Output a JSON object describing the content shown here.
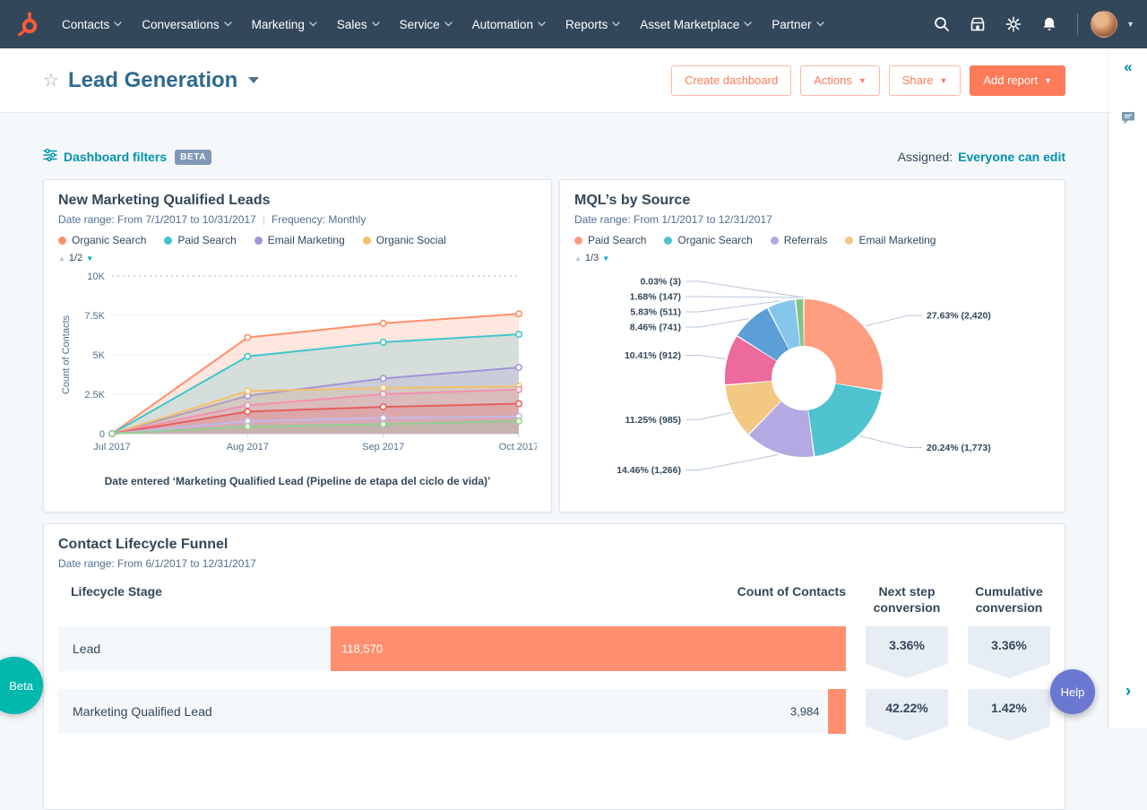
{
  "colors": {
    "primary": "#ff7a59",
    "link": "#0091ae",
    "nav": "#33475b"
  },
  "nav": {
    "items": [
      {
        "label": "Contacts"
      },
      {
        "label": "Conversations"
      },
      {
        "label": "Marketing"
      },
      {
        "label": "Sales"
      },
      {
        "label": "Service"
      },
      {
        "label": "Automation"
      },
      {
        "label": "Reports"
      },
      {
        "label": "Asset Marketplace"
      },
      {
        "label": "Partner"
      }
    ]
  },
  "header": {
    "title": "Lead Generation",
    "buttons": {
      "create_dashboard": "Create dashboard",
      "actions": "Actions",
      "share": "Share",
      "add_report": "Add report"
    }
  },
  "filters": {
    "label": "Dashboard filters",
    "beta": "BETA",
    "assigned_label": "Assigned:",
    "assigned_value": "Everyone can edit"
  },
  "chart_data": [
    {
      "type": "area",
      "title": "New Marketing Qualified Leads",
      "date_range": "Date range: From 7/1/2017 to 10/31/2017",
      "frequency": "Frequency: Monthly",
      "legend_page": "1/2",
      "x": [
        "Jul 2017",
        "Aug 2017",
        "Sep 2017",
        "Oct 2017"
      ],
      "ylabel": "Count of Contacts",
      "ylim": [
        0,
        10000
      ],
      "yticks": [
        "0",
        "2.5K",
        "5K",
        "7.5K",
        "10K"
      ],
      "series": [
        {
          "name": "Organic Search",
          "color": "#ff8f6b",
          "values": [
            0,
            6100,
            7000,
            7600
          ]
        },
        {
          "name": "Paid Search",
          "color": "#3fc6cd",
          "values": [
            0,
            4900,
            5800,
            6300
          ]
        },
        {
          "name": "Email Marketing",
          "color": "#a393d8",
          "values": [
            0,
            2400,
            3500,
            4200
          ]
        },
        {
          "name": "Organic Social",
          "color": "#f3c06e",
          "values": [
            0,
            2700,
            2900,
            3000
          ]
        },
        {
          "name": "",
          "color": "#f48fb1",
          "values": [
            0,
            1800,
            2500,
            2800
          ]
        },
        {
          "name": "",
          "color": "#e5605e",
          "values": [
            0,
            1400,
            1700,
            1900
          ]
        },
        {
          "name": "",
          "color": "#c5b9e8",
          "values": [
            0,
            800,
            1000,
            1100
          ]
        },
        {
          "name": "",
          "color": "#8fd08f",
          "values": [
            0,
            450,
            600,
            800
          ]
        }
      ],
      "caption": "Date entered ‘Marketing Qualified Lead (Pipeline de etapa del ciclo de vida)’"
    },
    {
      "type": "pie",
      "title": "MQL’s by Source",
      "date_range": "Date range: From 1/1/2017 to 12/31/2017",
      "legend_page": "1/3",
      "slices": [
        {
          "name": "Paid Search",
          "label": "27.63% (2,420)",
          "pct": 27.63,
          "count": 2420,
          "color": "#ff9d80"
        },
        {
          "name": "Organic Search",
          "label": "20.24% (1,773)",
          "pct": 20.24,
          "count": 1773,
          "color": "#4fc3cf"
        },
        {
          "name": "Referrals",
          "label": "14.46% (1,266)",
          "pct": 14.46,
          "count": 1266,
          "color": "#b5a9e3"
        },
        {
          "name": "Email Marketing",
          "label": "11.25% (985)",
          "pct": 11.25,
          "count": 985,
          "color": "#f3c883"
        },
        {
          "name": "",
          "label": "10.41% (912)",
          "pct": 10.41,
          "count": 912,
          "color": "#ec6a9c"
        },
        {
          "name": "",
          "label": "8.46% (741)",
          "pct": 8.46,
          "count": 741,
          "color": "#5b9fd6"
        },
        {
          "name": "",
          "label": "5.83% (511)",
          "pct": 5.83,
          "count": 511,
          "color": "#86c6ea"
        },
        {
          "name": "",
          "label": "1.68% (147)",
          "pct": 1.68,
          "count": 147,
          "color": "#7fc582"
        },
        {
          "name": "",
          "label": "0.03% (3)",
          "pct": 0.03,
          "count": 3,
          "color": "#b93c4e"
        }
      ]
    },
    {
      "type": "table",
      "title": "Contact Lifecycle Funnel",
      "date_range": "Date range: From 6/1/2017 to 12/31/2017",
      "columns": [
        "Lifecycle Stage",
        "Count of Contacts",
        "Next step conversion",
        "Cumulative conversion"
      ],
      "rows": [
        {
          "stage": "Lead",
          "count": "118,570",
          "count_value": 118570,
          "next_step": "3.36%",
          "cumulative": "3.36%",
          "bar_pct": 100
        },
        {
          "stage": "Marketing Qualified Lead",
          "count": "3,984",
          "count_value": 3984,
          "next_step": "42.22%",
          "cumulative": "1.42%",
          "bar_pct": 3.4
        }
      ]
    }
  ],
  "floating": {
    "beta": "Beta",
    "help": "Help"
  }
}
